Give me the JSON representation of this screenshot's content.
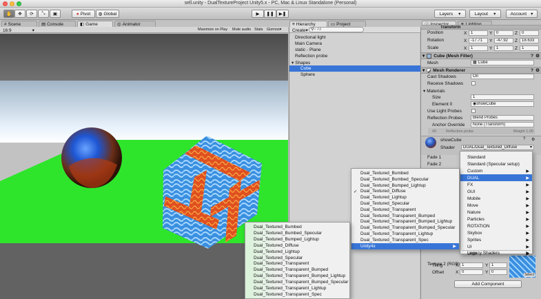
{
  "window": {
    "title": "sell.unity - DualTextureProject Unity5.x - PC, Mac & Linux Standalone (Personal)"
  },
  "toolbar": {
    "pivot": "Pivot",
    "global": "Global",
    "layers": "Layers",
    "layout": "Layout",
    "account": "Account"
  },
  "tabs": {
    "scene": "Scene",
    "console": "Console",
    "game": "Game",
    "animator": "Animator",
    "hierarchy": "Hierarchy",
    "project": "Project",
    "inspector": "Inspector",
    "lighting": "Lighting"
  },
  "game": {
    "aspect": "16:9",
    "maximize": "Maximize on Play",
    "mute": "Mute audio",
    "stats": "Stats",
    "gizmos": "Gizmos"
  },
  "hierarchy": {
    "create": "Create",
    "search_placeholder": "▿ All",
    "items": [
      "Directional light",
      "Main Camera",
      "static - Plane",
      "Reflection probe",
      "Shapes",
      "Cube",
      "Sphere"
    ]
  },
  "inspector": {
    "transform": {
      "title": "Transform",
      "position": "Position",
      "rotation": "Rotation",
      "scale": "Scale",
      "pos": [
        "1",
        "0",
        "0"
      ],
      "rot": [
        "-17.71",
        "-47.92",
        "18.633"
      ],
      "scl": [
        "1",
        "1",
        "1"
      ],
      "x": "X",
      "y": "Y",
      "z": "Z"
    },
    "meshfilter": {
      "title": "Cube (Mesh Filter)",
      "mesh_label": "Mesh",
      "mesh_value": "Cube"
    },
    "renderer": {
      "title": "Mesh Renderer",
      "cast": "Cast Shadows",
      "cast_v": "On",
      "receive": "Receive Shadows",
      "materials": "Materials",
      "size": "Size",
      "size_v": "1",
      "element": "Element 0",
      "element_v": "showCube",
      "probes": "Use Light Probes",
      "refl": "Reflection Probes",
      "refl_v": "Blend Probes",
      "anchor": "Anchor Override",
      "anchor_v": "None (Transform)",
      "probe_idx": "#0",
      "probe_name": "Reflection probe",
      "weight": "Weight 1.00"
    },
    "material": {
      "name": "showCube",
      "shader_label": "Shader",
      "shader_v": "DUAL/Dual_Textured_Diffuse",
      "fade1": "Fade 1",
      "fade2": "Fade 2",
      "tex2": "Texture 2 (RGB)",
      "tiling": "Tiling",
      "offset": "Offset",
      "tiling_v": [
        "1",
        "1"
      ],
      "offset_v": [
        "0",
        "0"
      ],
      "select": "Select"
    },
    "add_component": "Add Component"
  },
  "shader_menu": {
    "items": [
      "Standard",
      "Standard (Specular setup)",
      "Custom",
      "DUAL",
      "FX",
      "GUI",
      "Mobile",
      "Move",
      "Nature",
      "Particles",
      "ROTATION",
      "Skybox",
      "Sprites",
      "UI",
      "Unlit",
      "Legacy Shaders"
    ],
    "selected": 3
  },
  "dual_menu": {
    "items": [
      "Dual_Textured_Bumbed",
      "Dual_Textured_Bumbed_Specular",
      "Dual_Textured_Bumped_Lightup",
      "Dual_Textured_Diffuse",
      "Dual_Textured_Lightup",
      "Dual_Textured_Specular",
      "Dual_Textured_Transparent",
      "Dual_Textured_Transparent_Bumped",
      "Dual_Textured_Transparent_Bumped_Lightup",
      "Dual_Textured_Transparent_Bumped_Specular",
      "Dual_Textured_Transparent_Lightup",
      "Dual_Textured_Transparent_Spec",
      "Unity4x"
    ],
    "checked": 3,
    "selected": 12
  },
  "unity4x_menu": {
    "items": [
      "Dual_Textured_Bumbed",
      "Dual_Textured_Bumbed_Specular",
      "Dual_Textured_Bumped_Lightup",
      "Dual_Textured_Diffuse",
      "Dual_Textured_Lightup",
      "Dual_Textured_Specular",
      "Dual_Textured_Transparent",
      "Dual_Textured_Transparent_Bumped",
      "Dual_Textured_Transparent_Bumped_Lightup",
      "Dual_Textured_Transparent_Bumped_Specular",
      "Dual_Textured_Transparent_Lightup",
      "Dual_Textured_Transparent_Spec"
    ]
  },
  "colors": {
    "accent": "#3875d7",
    "ground": "#2ee52c",
    "sky": "#6a6a6a"
  }
}
